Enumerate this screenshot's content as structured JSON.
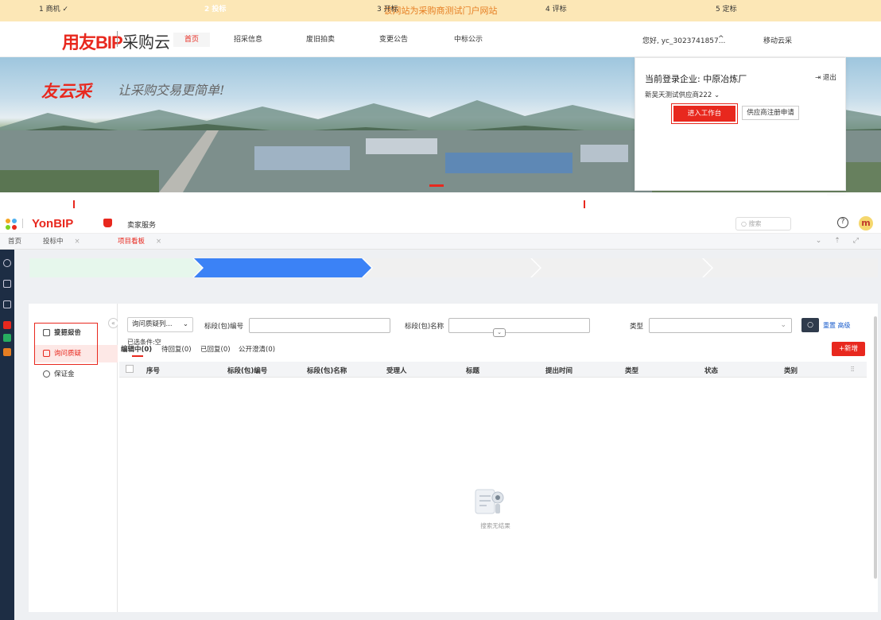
{
  "banner": "该网站为采购商测试门户网站",
  "portal": {
    "logo_main": "用友BIP",
    "logo_sub": "采购云",
    "nav": [
      "首页",
      "招采信息",
      "废旧拍卖",
      "变更公告",
      "中标公示"
    ],
    "user": "您好, yc_3023741857...",
    "user_caret": "^",
    "mobile": "移动云采"
  },
  "hero": {
    "brand": "友云采",
    "slogan": "让采购交易更简单!"
  },
  "login_card": {
    "title": "当前登录企业: 中原冶炼厂",
    "exit": "退出",
    "supplier": "新吴天测试供应商222",
    "enter_btn": "进入工作台",
    "register_btn": "供应商注册申请"
  },
  "app": {
    "logo": "YonBIP",
    "seller": "卖家服务",
    "search_placeholder": "搜索",
    "avatar": "m",
    "tabs": [
      "首页",
      "投标中",
      "项目看板"
    ]
  },
  "steps": [
    "1 商机 ✓",
    "2 投标",
    "3 开标",
    "4 评标",
    "5 定标"
  ],
  "left_menu": [
    "投标报价",
    "变更公告",
    "询问质疑",
    "保证金"
  ],
  "filters": {
    "select": "询问质疑列...",
    "code_label": "标段(包)编号",
    "name_label": "标段(包)名称",
    "type_label": "类型",
    "reset": "重置",
    "advanced": "高级",
    "conditions": "已选条件:空"
  },
  "subtabs": [
    "编辑中(0)",
    "待回复(0)",
    "已回复(0)",
    "公开澄清(0)"
  ],
  "add_button": "+新增",
  "columns": [
    "序号",
    "标段(包)编号",
    "标段(包)名称",
    "受理人",
    "标题",
    "提出时间",
    "类型",
    "状态",
    "类别"
  ],
  "empty_text": "搜索无结果",
  "colors": {
    "accent": "#e8281e",
    "step_active": "#3b82f6",
    "step_done": "#e6f7ec"
  }
}
